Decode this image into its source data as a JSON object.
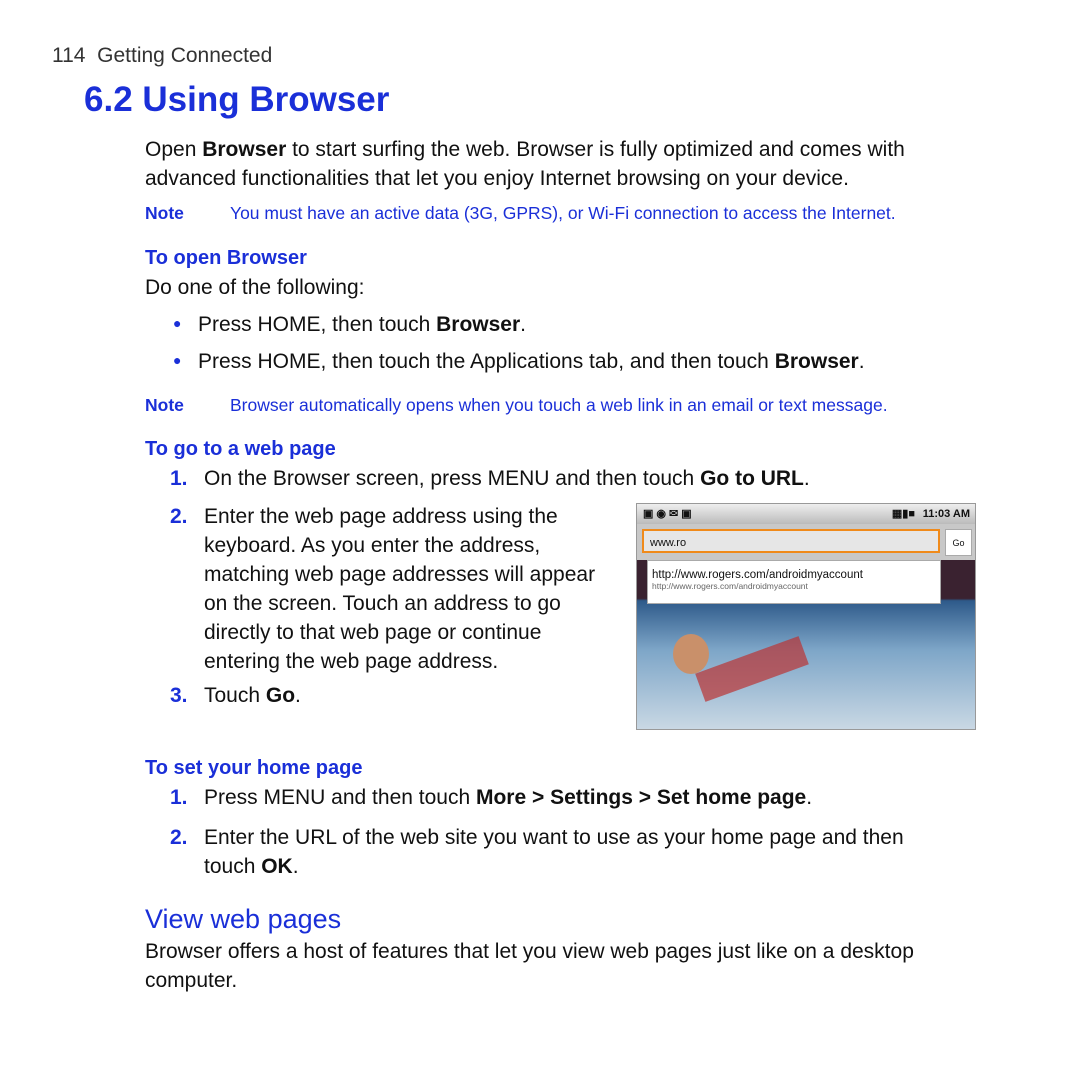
{
  "header": {
    "page_number": "114",
    "section": "Getting Connected"
  },
  "title": "6.2  Using Browser",
  "intro": {
    "a": "Open ",
    "b": "Browser",
    "c": " to start surfing the web. Browser is fully optimized and comes with",
    "line2": "advanced functionalities that let you enjoy Internet browsing on your device."
  },
  "note1": {
    "label": "Note",
    "text": "You must have an active data (3G, GPRS), or Wi-Fi connection to access the Internet."
  },
  "open": {
    "heading": "To open Browser",
    "lead": "Do one of the following:",
    "bullets": [
      {
        "a": "Press HOME, then touch ",
        "b": "Browser",
        "c": "."
      },
      {
        "a": "Press HOME, then touch the Applications tab, and then touch ",
        "b": "Browser",
        "c": "."
      }
    ]
  },
  "note2": {
    "label": "Note",
    "text": "Browser automatically opens when you touch a web link in an email or text message."
  },
  "goto": {
    "heading": "To go to a web page",
    "steps": [
      {
        "n": "1.",
        "a": "On the Browser screen, press MENU and then touch ",
        "b": "Go to URL",
        "c": "."
      },
      {
        "n": "2.",
        "lines": [
          "Enter the web page address using the",
          "keyboard. As you enter the address,",
          "matching web page addresses will appear",
          "on the screen. Touch an address to go",
          "directly to that web page or continue",
          "entering the web page address."
        ]
      },
      {
        "n": "3.",
        "a": "Touch ",
        "b": "Go",
        "c": "."
      }
    ]
  },
  "phone": {
    "time": "11:03 AM",
    "url_value": "www.ro",
    "go_label": "Go",
    "suggestion_title": "http://www.rogers.com/androidmyaccount",
    "suggestion_url": "http://www.rogers.com/androidmyaccount"
  },
  "home": {
    "heading": "To set your home page",
    "steps": [
      {
        "n": "1.",
        "a": "Press MENU and then touch ",
        "b": "More > Settings > Set home page",
        "c": "."
      },
      {
        "n": "2.",
        "a": "Enter the URL of the web site you want to use as your home page and then",
        "a2": "touch ",
        "b": "OK",
        "c": "."
      }
    ]
  },
  "view": {
    "heading": "View web pages",
    "line1": "Browser offers a host of features that let you view web pages just like on a desktop",
    "line2": "computer."
  }
}
